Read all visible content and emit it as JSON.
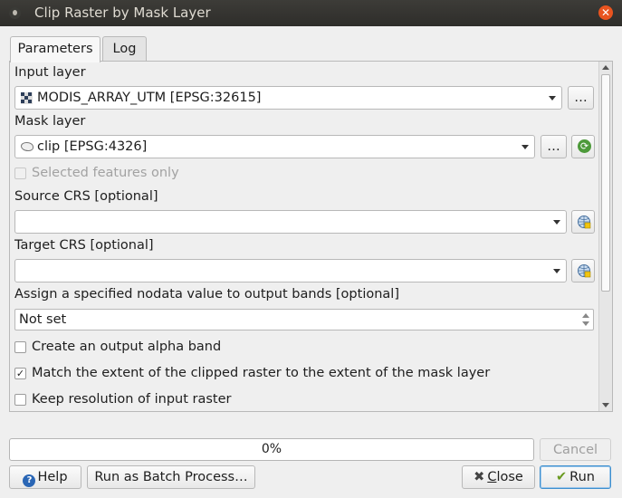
{
  "window": {
    "title": "Clip Raster by Mask Layer"
  },
  "tabs": [
    {
      "label": "Parameters"
    },
    {
      "label": "Log"
    }
  ],
  "params": {
    "input_layer": {
      "label": "Input layer",
      "value": "MODIS_ARRAY_UTM [EPSG:32615]",
      "browse": "…"
    },
    "mask_layer": {
      "label": "Mask layer",
      "value": "clip [EPSG:4326]",
      "browse": "…"
    },
    "selected_only": {
      "label": "Selected features only",
      "checked": false
    },
    "source_crs": {
      "label": "Source CRS [optional]",
      "value": ""
    },
    "target_crs": {
      "label": "Target CRS [optional]",
      "value": ""
    },
    "nodata": {
      "label": "Assign a specified nodata value to output bands [optional]",
      "value": "Not set"
    },
    "alpha_band": {
      "label": "Create an output alpha band",
      "checked": false
    },
    "match_extent": {
      "label": "Match the extent of the clipped raster to the extent of the mask layer",
      "checked": true
    },
    "keep_resolution": {
      "label": "Keep resolution of input raster",
      "checked": false
    }
  },
  "progress": {
    "text": "0%",
    "value": 0
  },
  "buttons": {
    "cancel": "Cancel",
    "help": "Help",
    "batch": "Run as Batch Process…",
    "close_first": "C",
    "close_rest": "lose",
    "run": "Run"
  },
  "colors": {
    "titlebar": "#3d3c38",
    "close": "#e9541f",
    "run_border": "#3c8ece"
  }
}
